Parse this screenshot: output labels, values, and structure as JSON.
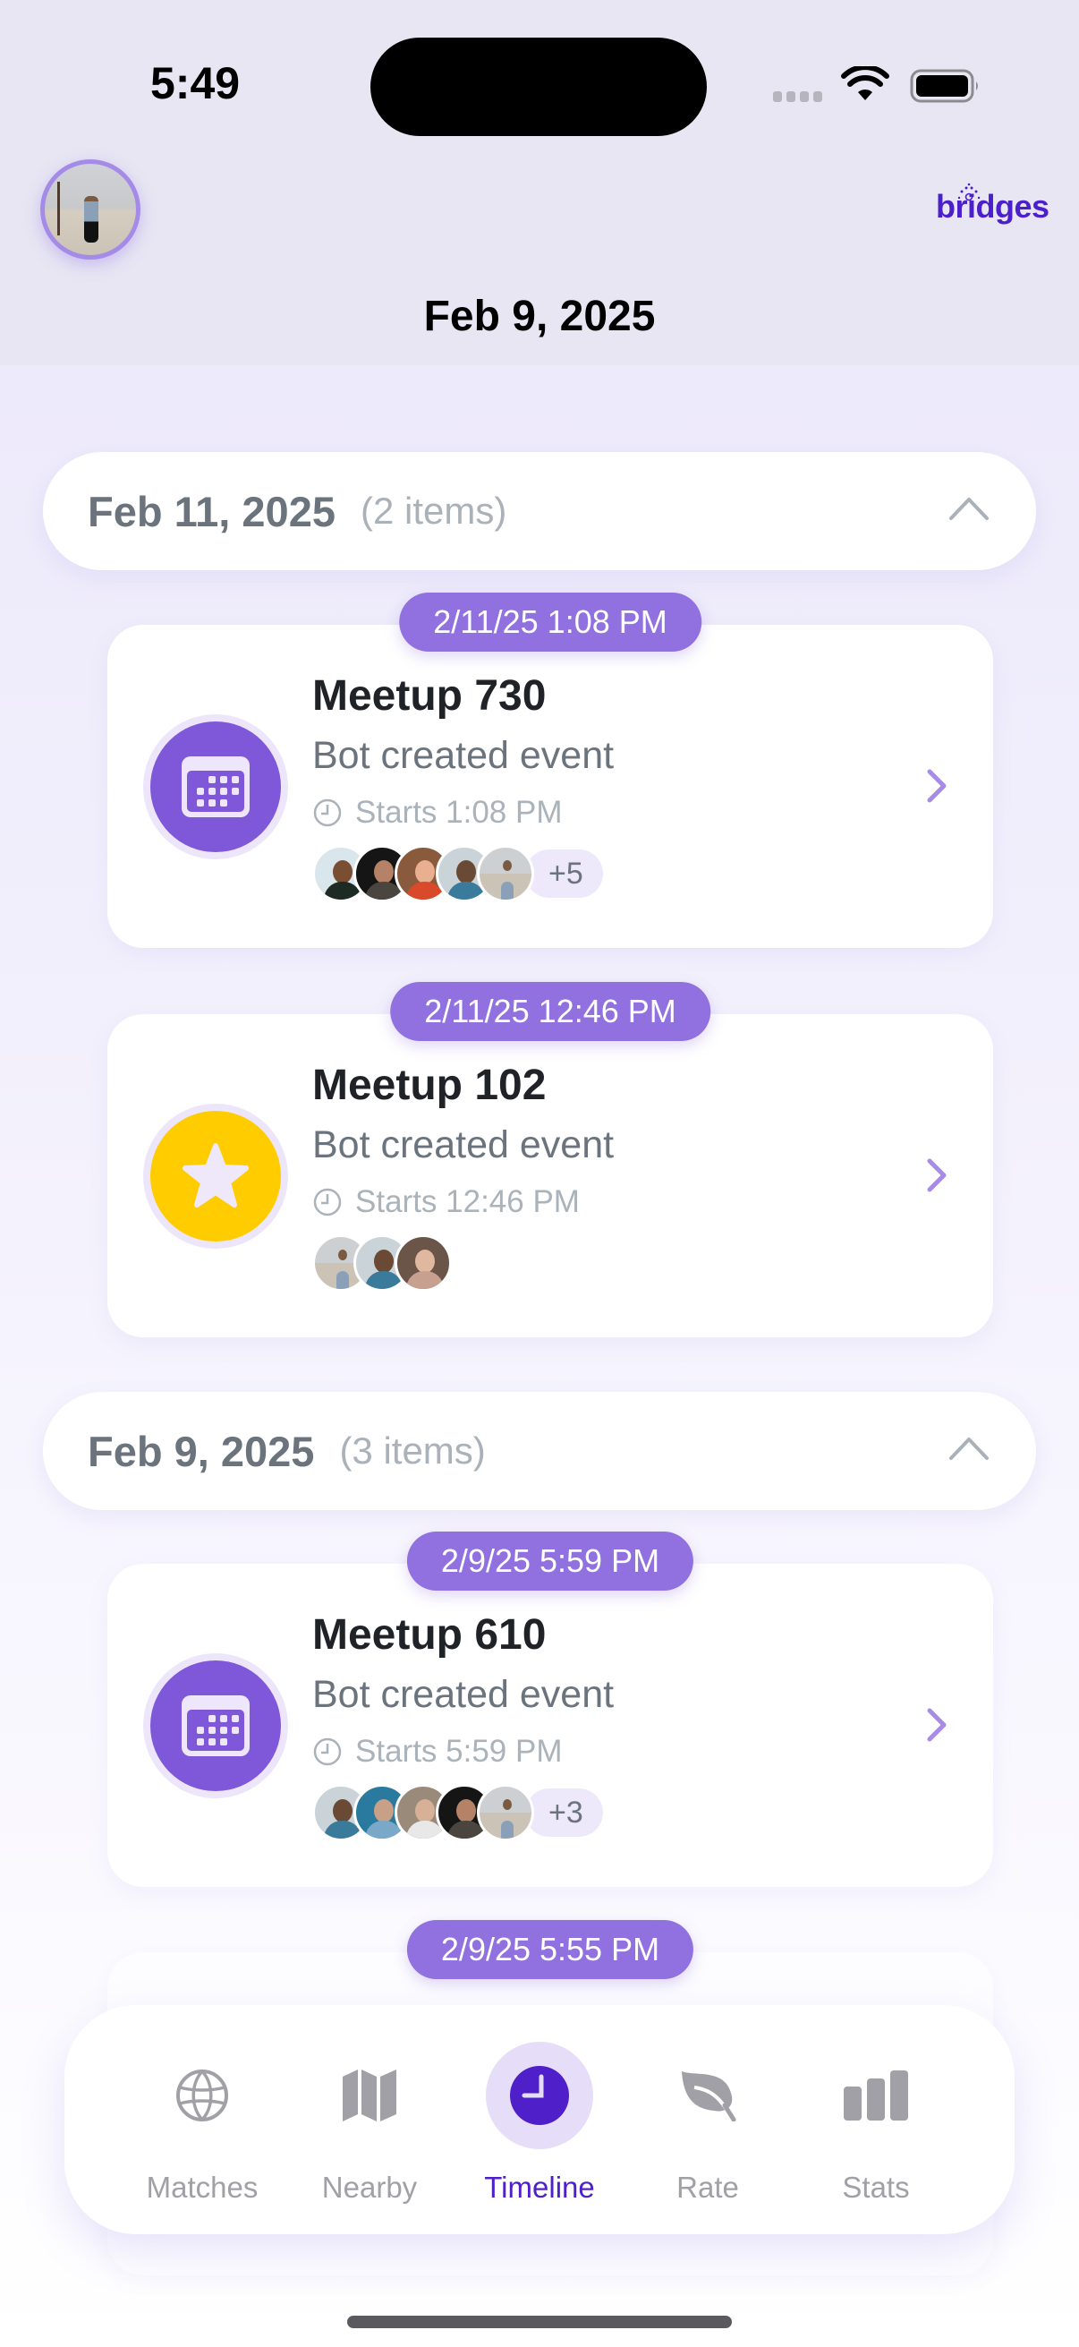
{
  "status_bar": {
    "time": "5:49"
  },
  "header": {
    "brand": "bridges",
    "current_date": "Feb 9, 2025"
  },
  "colors": {
    "accent": "#4f1fc9",
    "pill": "#9170df",
    "event_icon_purple": "#7f58d9",
    "event_icon_yellow": "#ffcc00",
    "tab_inactive": "#a0a0a6"
  },
  "sections": [
    {
      "date": "Feb 11, 2025",
      "count": "(2 items)",
      "expanded": true,
      "items": [
        {
          "timestamp": "2/11/25  1:08 PM",
          "title": "Meetup 730",
          "subtitle": "Bot created event",
          "starts": "Starts 1:08 PM",
          "icon": "calendar-icon",
          "icon_color": "purple",
          "attendee_count_shown": 5,
          "more": "+5"
        },
        {
          "timestamp": "2/11/25  12:46 PM",
          "title": "Meetup 102",
          "subtitle": "Bot created event",
          "starts": "Starts 12:46 PM",
          "icon": "star-icon",
          "icon_color": "yellow",
          "attendee_count_shown": 3,
          "more": ""
        }
      ]
    },
    {
      "date": "Feb 9, 2025",
      "count": "(3 items)",
      "expanded": true,
      "items": [
        {
          "timestamp": "2/9/25  5:59 PM",
          "title": "Meetup 610",
          "subtitle": "Bot created event",
          "starts": "Starts 5:59 PM",
          "icon": "calendar-icon",
          "icon_color": "purple",
          "attendee_count_shown": 5,
          "more": "+3"
        },
        {
          "timestamp": "2/9/25  5:55 PM"
        }
      ]
    }
  ],
  "tabs": [
    {
      "label": "Matches",
      "icon": "globe-icon",
      "active": false
    },
    {
      "label": "Nearby",
      "icon": "map-icon",
      "active": false
    },
    {
      "label": "Timeline",
      "icon": "clock-icon",
      "active": true
    },
    {
      "label": "Rate",
      "icon": "leaf-icon",
      "active": false
    },
    {
      "label": "Stats",
      "icon": "bar-chart-icon",
      "active": false
    }
  ]
}
